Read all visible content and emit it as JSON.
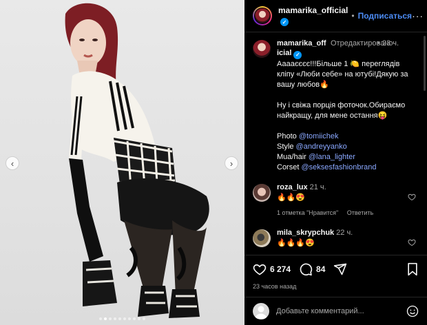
{
  "post": {
    "username": "mamarika_official",
    "follow_label": "Подписаться",
    "separator": "•",
    "more_label": "···",
    "photo_count": 10,
    "active_photo": 1
  },
  "caption": {
    "username": "mamarika_official",
    "edited": "Отредактировано",
    "time": "23 ч.",
    "lines": [
      "Ааааєєєє!!!Більше 1 🍋 переглядів кліпу «Люби себе» на ютубі!Дякую за вашу любов🔥",
      "",
      "Ну і свіжа порція фоточок.Обираємо найкращу, для мене остання😝",
      ""
    ],
    "credits": [
      {
        "label": "Photo",
        "mention": "@tomiichek"
      },
      {
        "label": "Style",
        "mention": "@andreyyanko"
      },
      {
        "label": "Mua/hair",
        "mention": "@lana_lighter"
      },
      {
        "label": "Corset",
        "mention": "@seksesfashionbrand"
      }
    ]
  },
  "comments": [
    {
      "username": "roza_lux",
      "time": "21 ч.",
      "text": "🔥🔥😍",
      "likes_label": "1 отметка \"Нравится\"",
      "reply_label": "Ответить"
    },
    {
      "username": "mila_skrypchuk",
      "time": "22 ч.",
      "text": "🔥🔥🔥😍"
    }
  ],
  "stats": {
    "likes": "6 274",
    "comments": "84",
    "posted": "23 часов назад"
  },
  "add_comment": {
    "placeholder": "Добавьте комментарий..."
  },
  "nav": {
    "prev": "‹",
    "next": "›"
  },
  "colors": {
    "accent": "#4c8cf5",
    "verified": "#0095f6",
    "background": "#000000",
    "muted": "#a8a8a8"
  }
}
